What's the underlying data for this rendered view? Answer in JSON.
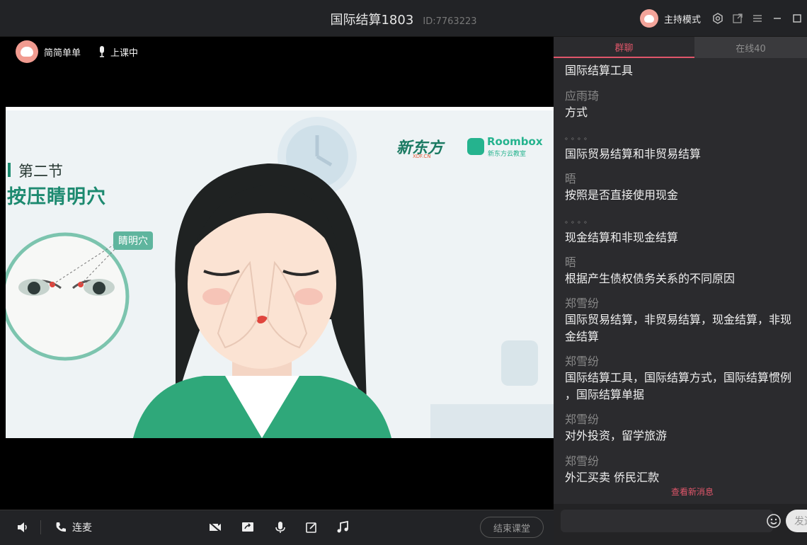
{
  "window": {
    "title": "国际结算1803",
    "room_id": "ID:7763223",
    "mode_label": "主持模式"
  },
  "teacher": {
    "name": "简简单单",
    "status": "上课中"
  },
  "slide": {
    "section": "第二节",
    "title": "按压睛明穴",
    "point_label": "睛明穴",
    "logo_main": "新东方",
    "logo_main_sub": "XDF.CN",
    "logo_room": "Roombox",
    "logo_room_sub": "新东方云教室"
  },
  "controls": {
    "mic_connect_label": "连麦",
    "end_class_label": "结束课堂"
  },
  "chat": {
    "tabs": [
      {
        "label": "群聊"
      },
      {
        "label": "在线40"
      }
    ],
    "messages": [
      {
        "sender": "",
        "text": "国际结算工具"
      },
      {
        "sender": "应雨琦",
        "text": "方式"
      },
      {
        "sender": "。。。。",
        "text": "国际贸易结算和非贸易结算"
      },
      {
        "sender": "晤",
        "text": "按照是否直接使用现金"
      },
      {
        "sender": "。。。。",
        "text": "现金结算和非现金结算"
      },
      {
        "sender": "晤",
        "text": "根据产生债权债务关系的不同原因"
      },
      {
        "sender": "郑雪纷",
        "text": "国际贸易结算，非贸易结算，现金结算，非现",
        "text2": "金结算"
      },
      {
        "sender": "郑雪纷",
        "text": "国际结算工具，国际结算方式，国际结算惯例",
        "text2": "，国际结算单据"
      },
      {
        "sender": "郑雪纷",
        "text": "对外投资，留学旅游"
      },
      {
        "sender": "郑雪纷",
        "text": "外汇买卖 侨民汇款"
      }
    ],
    "new_message_hint": "查看新消息",
    "input_placeholder": "",
    "send_label": "发送"
  }
}
